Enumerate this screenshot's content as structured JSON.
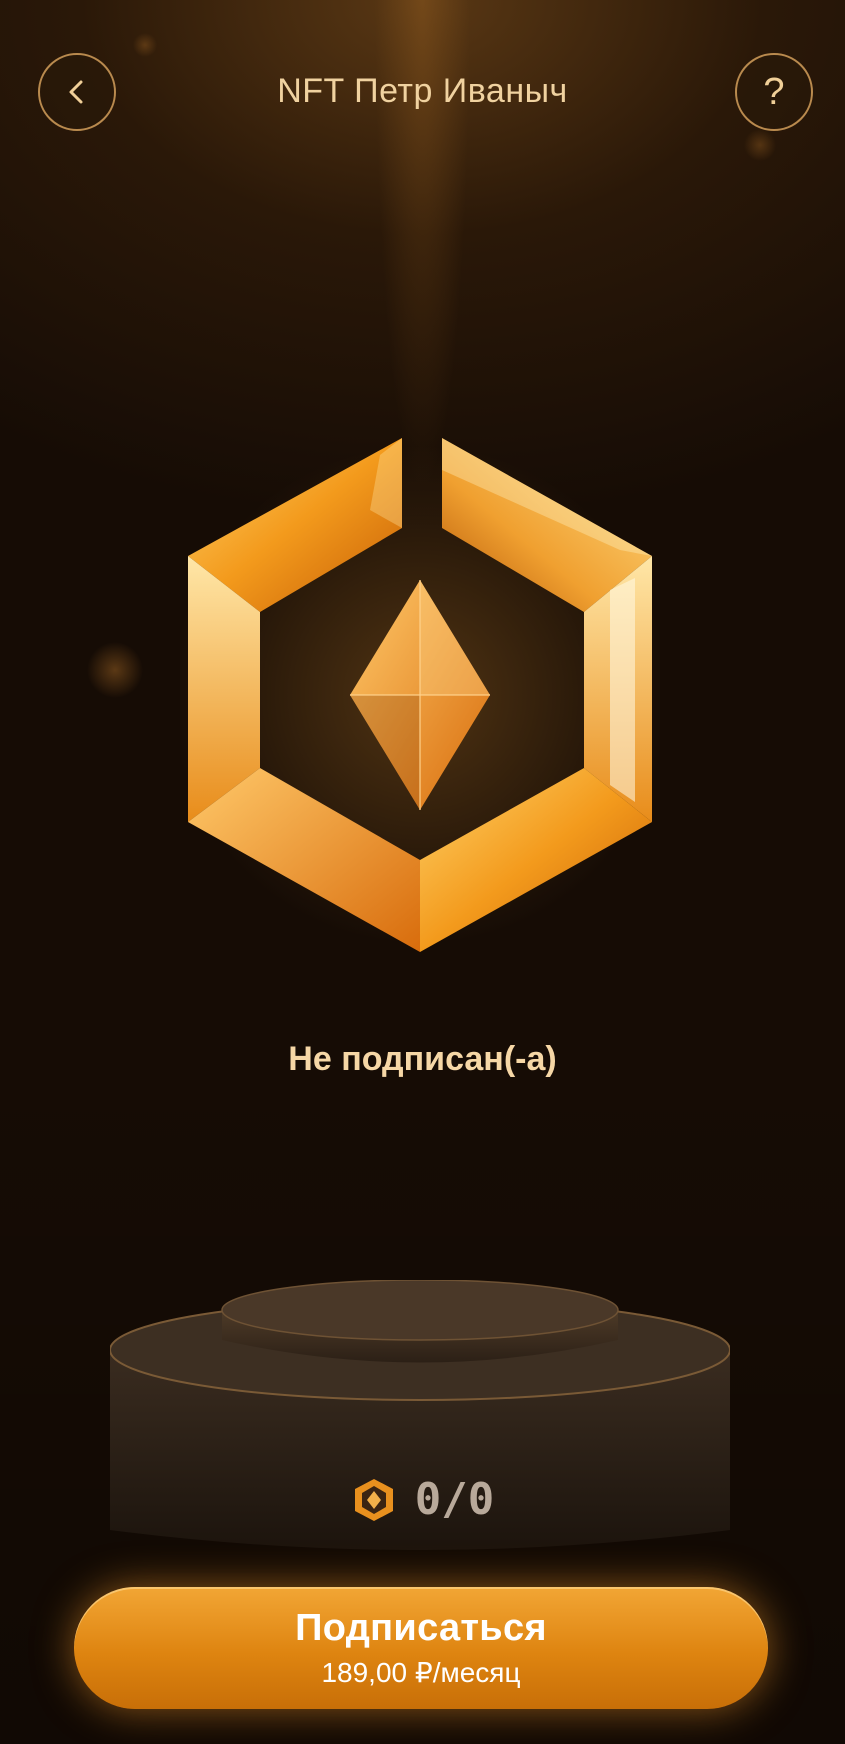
{
  "header": {
    "title": "NFT Петр Иваныч",
    "help_label": "?"
  },
  "status": {
    "text": "Не подписан(-а)"
  },
  "counter": {
    "text": "0/0"
  },
  "subscribe": {
    "label": "Подписаться",
    "price": "189,00 ₽/месяц"
  },
  "colors": {
    "accent": "#e38a16",
    "text_gold": "#f2d29a",
    "background": "#1c1007"
  }
}
